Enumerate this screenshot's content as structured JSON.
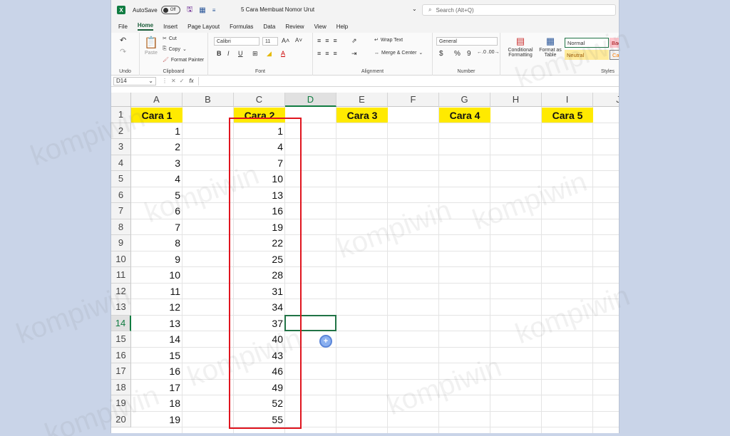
{
  "titlebar": {
    "autosave_label": "AutoSave",
    "autosave_state": "Off",
    "doc_title": "5 Cara Membuat Nomor Urut",
    "search_placeholder": "Search (Alt+Q)"
  },
  "menu": [
    "File",
    "Home",
    "Insert",
    "Page Layout",
    "Formulas",
    "Data",
    "Review",
    "View",
    "Help"
  ],
  "active_menu": "Home",
  "ribbon": {
    "undo_label": "Undo",
    "paste_label": "Paste",
    "cut_label": "Cut",
    "copy_label": "Copy",
    "format_painter_label": "Format Painter",
    "clipboard_label": "Clipboard",
    "font_name": "Calibri",
    "font_size": "11",
    "font_label": "Font",
    "bold": "B",
    "italic": "I",
    "underline": "U",
    "wrap_text_label": "Wrap Text",
    "merge_center_label": "Merge & Center",
    "alignment_label": "Alignment",
    "number_format": "General",
    "currency": "$",
    "percent": "%",
    "comma": "9",
    "number_label": "Number",
    "conditional_formatting": "Conditional Formatting",
    "format_as_table": "Format as Table",
    "style_normal": "Normal",
    "style_neutral": "Neutral",
    "style_bad": "Bad",
    "style_calc": "Cal",
    "styles_label": "Styles"
  },
  "formula_bar": {
    "name_box": "D14",
    "fx_label": "fx",
    "content": ""
  },
  "columns": [
    "A",
    "B",
    "C",
    "D",
    "E",
    "F",
    "G",
    "H",
    "I",
    "J"
  ],
  "selected_column": "D",
  "rows": [
    "1",
    "2",
    "3",
    "4",
    "5",
    "6",
    "7",
    "8",
    "9",
    "10",
    "11",
    "12",
    "13",
    "14",
    "15",
    "16",
    "17",
    "18",
    "19",
    "20"
  ],
  "selected_row": "14",
  "headers": {
    "A1": "Cara 1",
    "C1": "Cara 2",
    "E1": "Cara 3",
    "G1": "Cara 4",
    "I1": "Cara 5"
  },
  "column_a": [
    "1",
    "2",
    "3",
    "4",
    "5",
    "6",
    "7",
    "8",
    "9",
    "10",
    "11",
    "12",
    "13",
    "14",
    "15",
    "16",
    "17",
    "18",
    "19"
  ],
  "column_c": [
    "1",
    "4",
    "7",
    "10",
    "13",
    "16",
    "19",
    "22",
    "25",
    "28",
    "31",
    "34",
    "37",
    "40",
    "43",
    "46",
    "49",
    "52",
    "55"
  ],
  "watermark": "kompiwin",
  "colors": {
    "header_fill": "#ffea00",
    "highlight_border": "#e0141e",
    "selection": "#217346"
  }
}
